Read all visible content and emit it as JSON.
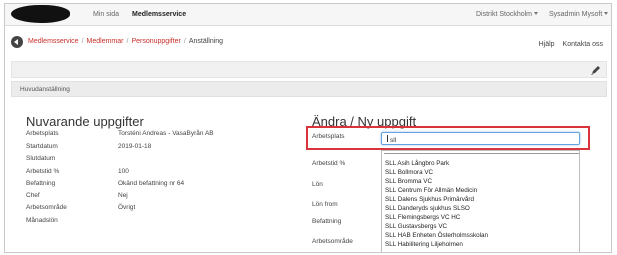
{
  "nav": {
    "my_page": "Min sida",
    "member_service": "Medlemsservice",
    "district": "Distrikt Stockholm",
    "user": "Sysadmin Mysoft"
  },
  "breadcrumb": {
    "items": [
      "Medlemsservice",
      "Medlemmar",
      "Personuppgifter",
      "Anställning"
    ]
  },
  "help": {
    "help": "Hjälp",
    "contact": "Kontakta oss"
  },
  "section": {
    "title": "Huvudanställning"
  },
  "current": {
    "title": "Nuvarande uppgifter",
    "rows": [
      {
        "label": "Arbetsplats",
        "value": "Torsténi Andreas - VasaByrån AB"
      },
      {
        "label": "Startdatum",
        "value": "2019-01-18"
      },
      {
        "label": "Slutdatum",
        "value": ""
      },
      {
        "label": "Arbetstid %",
        "value": "100"
      },
      {
        "label": "Befattning",
        "value": "Okänd befattning nr 64"
      },
      {
        "label": "Chef",
        "value": "Nej"
      },
      {
        "label": "Arbetsområde",
        "value": "Övrigt"
      },
      {
        "label": "Månadslön",
        "value": ""
      }
    ]
  },
  "edit": {
    "title": "Ändra / Ny uppgift",
    "workplace_label": "Arbetsplats",
    "workplace_value": "sll",
    "labels": {
      "hours": "Arbetstid %",
      "salary": "Lön",
      "salary_from": "Lön from",
      "position": "Befattning",
      "area": "Arbetsområde"
    },
    "options": [
      "SLL Asih Långbro Park",
      "SLL Bollmora VC",
      "SLL Bromma VC",
      "SLL Centrum För Allmän Medicin",
      "SLL Dalens Sjukhus Primärvård",
      "SLL Danderyds sjukhus SLSO",
      "SLL Flemingsbergs VC HC",
      "SLL Gustavsbergs VC",
      "SLL HAB Enheten Österholmsskolan",
      "SLL Habilitering Liljeholmen"
    ]
  }
}
